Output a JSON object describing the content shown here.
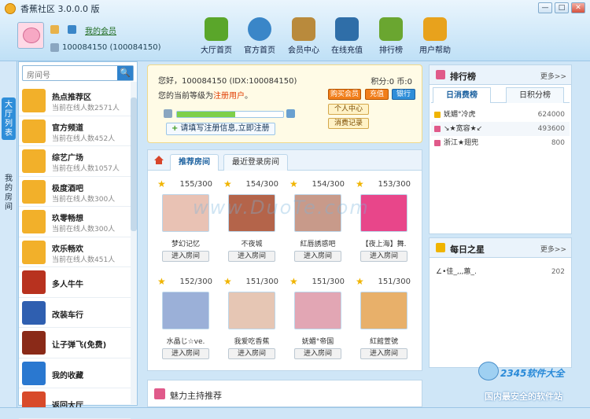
{
  "app": {
    "title": "香蕉社区 3.0.0.0 版",
    "win_min": "—",
    "win_max": "□",
    "win_close": "✕"
  },
  "user": {
    "member_link": "我的会员",
    "ids": "100084150 (100084150)"
  },
  "nav": [
    {
      "label": "大厅首页",
      "icon": "house-icon",
      "color": "#5aa62a"
    },
    {
      "label": "官方首页",
      "icon": "globe-icon",
      "color": "#3a86c8"
    },
    {
      "label": "会员中心",
      "icon": "book-icon",
      "color": "#b98a3c"
    },
    {
      "label": "在线充值",
      "icon": "user-card-icon",
      "color": "#2f6ea8"
    },
    {
      "label": "排行榜",
      "icon": "podium-icon",
      "color": "#6aa630"
    },
    {
      "label": "用户帮助",
      "icon": "chat-icon",
      "color": "#e8a21c"
    }
  ],
  "sidetabs": {
    "hall": "大厅列表",
    "mine": "我的房间"
  },
  "search": {
    "placeholder": "房间号",
    "button": "🔍"
  },
  "rooms_list": [
    {
      "name": "热点推荐区",
      "count": "当前在线人数2571人",
      "color": "#f2b02a"
    },
    {
      "name": "官方频道",
      "count": "当前在线人数452人",
      "color": "#f2b02a"
    },
    {
      "name": "综艺广场",
      "count": "当前在线人数1057人",
      "color": "#f2b02a"
    },
    {
      "name": "极度酒吧",
      "count": "当前在线人数300人",
      "color": "#f2b02a"
    },
    {
      "name": "玖零畅想",
      "count": "当前在线人数300人",
      "color": "#f2b02a"
    },
    {
      "name": "欢乐畅欢",
      "count": "当前在线人数451人",
      "color": "#f2b02a"
    },
    {
      "name": "多人牛牛",
      "count": "",
      "color": "#b8321f"
    },
    {
      "name": "改装车行",
      "count": "",
      "color": "#2f5fb0"
    },
    {
      "name": "让子弹飞(免费)",
      "count": "",
      "color": "#8a2a18"
    },
    {
      "name": "我的收藏",
      "count": "",
      "color": "#2a78d0"
    },
    {
      "name": "返回大厅",
      "count": "",
      "color": "#d84a2a"
    }
  ],
  "userbox": {
    "greeting": "您好，100084150 (IDX:100084150)",
    "score": "积分:0 币:0",
    "level_prefix": "您的当前等级为",
    "level_value": "注册用户",
    "level_suffix": "。",
    "buy_vip": "购买会员",
    "recharge": "充值",
    "bank": "银行",
    "personal_center": "个人中心",
    "consume_record": "消费记录",
    "register_prompt": "请填写注册信息,立即注册",
    "progress": 0.55
  },
  "room_tabs": {
    "recommended": "推荐房间",
    "recent": "最近登录房间"
  },
  "rooms": [
    {
      "count": "155/300",
      "name": "梦幻记忆",
      "enter": "进入房间",
      "color": "#e9c2b4"
    },
    {
      "count": "154/300",
      "name": "不夜城",
      "enter": "进入房间",
      "color": "#b4644a"
    },
    {
      "count": "154/300",
      "name": "紅唇誘惑吧",
      "enter": "进入房间",
      "color": "#c89a8a"
    },
    {
      "count": "153/300",
      "name": "【夜上海】舞.",
      "enter": "进入房间",
      "color": "#e8468a"
    },
    {
      "count": "152/300",
      "name": "水晶じ☆ve.",
      "enter": "进入房间",
      "color": "#9bb0d8"
    },
    {
      "count": "151/300",
      "name": "我爱吃香蕉",
      "enter": "进入房间",
      "color": "#e6c6b4"
    },
    {
      "count": "151/300",
      "name": "妩媚°帝国",
      "enter": "进入房间",
      "color": "#e2a6b4"
    },
    {
      "count": "151/300",
      "name": "紅館萱號",
      "enter": "进入房间",
      "color": "#e8b06a"
    }
  ],
  "host": {
    "title": "魅力主持推荐"
  },
  "ranking": {
    "title": "排行榜",
    "more": "更多>>",
    "tab_day": "日消费榜",
    "tab_day_points": "日积分榜",
    "rows": [
      {
        "name": "妩媚°冷虎",
        "score": "624000",
        "badge": "#f0b400"
      },
      {
        "name": "↘★宽容★↙",
        "score": "493600",
        "badge": "#e05a8a"
      },
      {
        "name": "浙江★翅兜",
        "score": "800",
        "badge": "#e05a8a"
      }
    ]
  },
  "daily_star": {
    "title": "每日之星",
    "more": "更多>>",
    "name": "∠•佳_,,,蕙_.",
    "score": "202"
  },
  "promo": {
    "brand": "2345软件大全",
    "tagline": "国内最安全的软件站"
  },
  "watermark": "www.DuoTe.com"
}
